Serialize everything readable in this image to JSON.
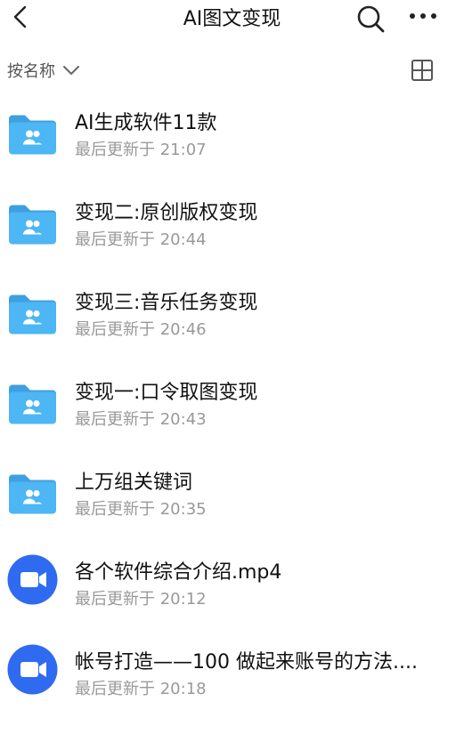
{
  "header": {
    "title": "AI图文变现"
  },
  "toolbar": {
    "sort_label": "按名称"
  },
  "files": [
    {
      "name": "AI生成软件11款",
      "time": "最后更新于 21:07",
      "type": "folder"
    },
    {
      "name": "变现二:原创版权变现",
      "time": "最后更新于 20:44",
      "type": "folder"
    },
    {
      "name": "变现三:音乐任务变现",
      "time": "最后更新于 20:46",
      "type": "folder"
    },
    {
      "name": "变现一:口令取图变现",
      "time": "最后更新于 20:43",
      "type": "folder"
    },
    {
      "name": "上万组关键词",
      "time": "最后更新于 20:35",
      "type": "folder"
    },
    {
      "name": "各个软件综合介绍.mp4",
      "time": "最后更新于 20:12",
      "type": "video"
    },
    {
      "name": "帐号打造——100 做起来账号的方法....",
      "time": "最后更新于 20:18",
      "type": "video"
    }
  ],
  "icons": {
    "back": "back-arrow-icon",
    "search": "search-icon",
    "more": "more-dots-icon",
    "sort_chevron": "chevron-down-icon",
    "view": "grid-view-icon",
    "folder": "shared-folder-icon",
    "video": "video-file-icon"
  },
  "colors": {
    "folder": "#4DB6F4",
    "folder_tab": "#3FA0E0",
    "video": "#2F6BF0",
    "text": "#111111",
    "subtext": "#999999"
  }
}
